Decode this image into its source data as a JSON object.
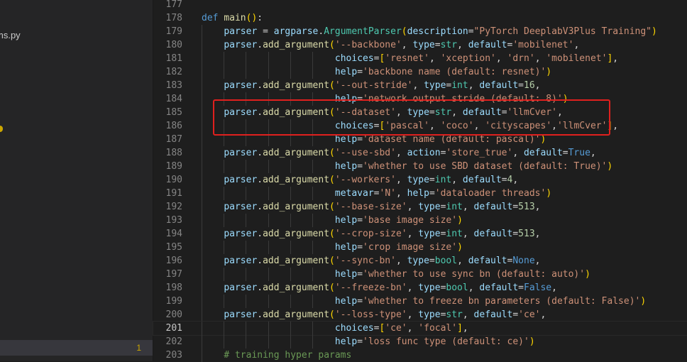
{
  "sidebar": {
    "file_label": "ms.py",
    "selected_badge": "1"
  },
  "colors": {
    "background": "#1e1e1e",
    "sidebar": "#252526",
    "keyword": "#569cd6",
    "function": "#dcdcaa",
    "string": "#ce9178",
    "number": "#b5cea8",
    "builtin": "#4ec9b0",
    "comment": "#6a9955",
    "highlight_box": "#e0201e"
  },
  "editor": {
    "active_line": "201",
    "lines": [
      {
        "num": "177",
        "text": ""
      },
      {
        "num": "178",
        "text": "def main():"
      },
      {
        "num": "179",
        "text": "    parser = argparse.ArgumentParser(description=\"PyTorch DeeplabV3Plus Training\")"
      },
      {
        "num": "180",
        "text": "    parser.add_argument('--backbone', type=str, default='mobilenet',"
      },
      {
        "num": "181",
        "text": "                        choices=['resnet', 'xception', 'drn', 'mobilenet'],"
      },
      {
        "num": "182",
        "text": "                        help='backbone name (default: resnet)')"
      },
      {
        "num": "183",
        "text": "    parser.add_argument('--out-stride', type=int, default=16,"
      },
      {
        "num": "184",
        "text": "                        help='network output stride (default: 8)')"
      },
      {
        "num": "185",
        "text": "    parser.add_argument('--dataset', type=str, default='llmCver',"
      },
      {
        "num": "186",
        "text": "                        choices=['pascal', 'coco', 'cityscapes','llmCver'],"
      },
      {
        "num": "187",
        "text": "                        help='dataset name (default: pascal)')"
      },
      {
        "num": "188",
        "text": "    parser.add_argument('--use-sbd', action='store_true', default=True,"
      },
      {
        "num": "189",
        "text": "                        help='whether to use SBD dataset (default: True)')"
      },
      {
        "num": "190",
        "text": "    parser.add_argument('--workers', type=int, default=4,"
      },
      {
        "num": "191",
        "text": "                        metavar='N', help='dataloader threads')"
      },
      {
        "num": "192",
        "text": "    parser.add_argument('--base-size', type=int, default=513,"
      },
      {
        "num": "193",
        "text": "                        help='base image size')"
      },
      {
        "num": "194",
        "text": "    parser.add_argument('--crop-size', type=int, default=513,"
      },
      {
        "num": "195",
        "text": "                        help='crop image size')"
      },
      {
        "num": "196",
        "text": "    parser.add_argument('--sync-bn', type=bool, default=None,"
      },
      {
        "num": "197",
        "text": "                        help='whether to use sync bn (default: auto)')"
      },
      {
        "num": "198",
        "text": "    parser.add_argument('--freeze-bn', type=bool, default=False,"
      },
      {
        "num": "199",
        "text": "                        help='whether to freeze bn parameters (default: False)')"
      },
      {
        "num": "200",
        "text": "    parser.add_argument('--loss-type', type=str, default='ce',"
      },
      {
        "num": "201",
        "text": "                        choices=['ce', 'focal'],"
      },
      {
        "num": "202",
        "text": "                        help='loss func type (default: ce)')"
      },
      {
        "num": "203",
        "text": "    # training hyper params"
      }
    ]
  }
}
